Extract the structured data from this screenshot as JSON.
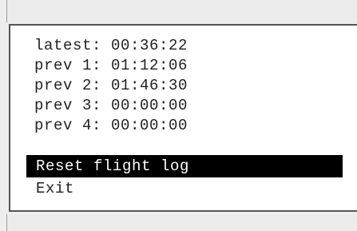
{
  "flight_log": {
    "rows": [
      {
        "label": "latest:",
        "time": "00:36:22"
      },
      {
        "label": "prev 1:",
        "time": "01:12:06"
      },
      {
        "label": "prev 2:",
        "time": "01:46:30"
      },
      {
        "label": "prev 3:",
        "time": "00:00:00"
      },
      {
        "label": "prev 4:",
        "time": "00:00:00"
      }
    ]
  },
  "menu": {
    "items": [
      {
        "label": "Reset flight log",
        "selected": true
      },
      {
        "label": "Exit",
        "selected": false
      }
    ]
  },
  "colors": {
    "selection_background": "#000000",
    "selection_text": "#ffffff",
    "panel_background": "#ffffff"
  }
}
